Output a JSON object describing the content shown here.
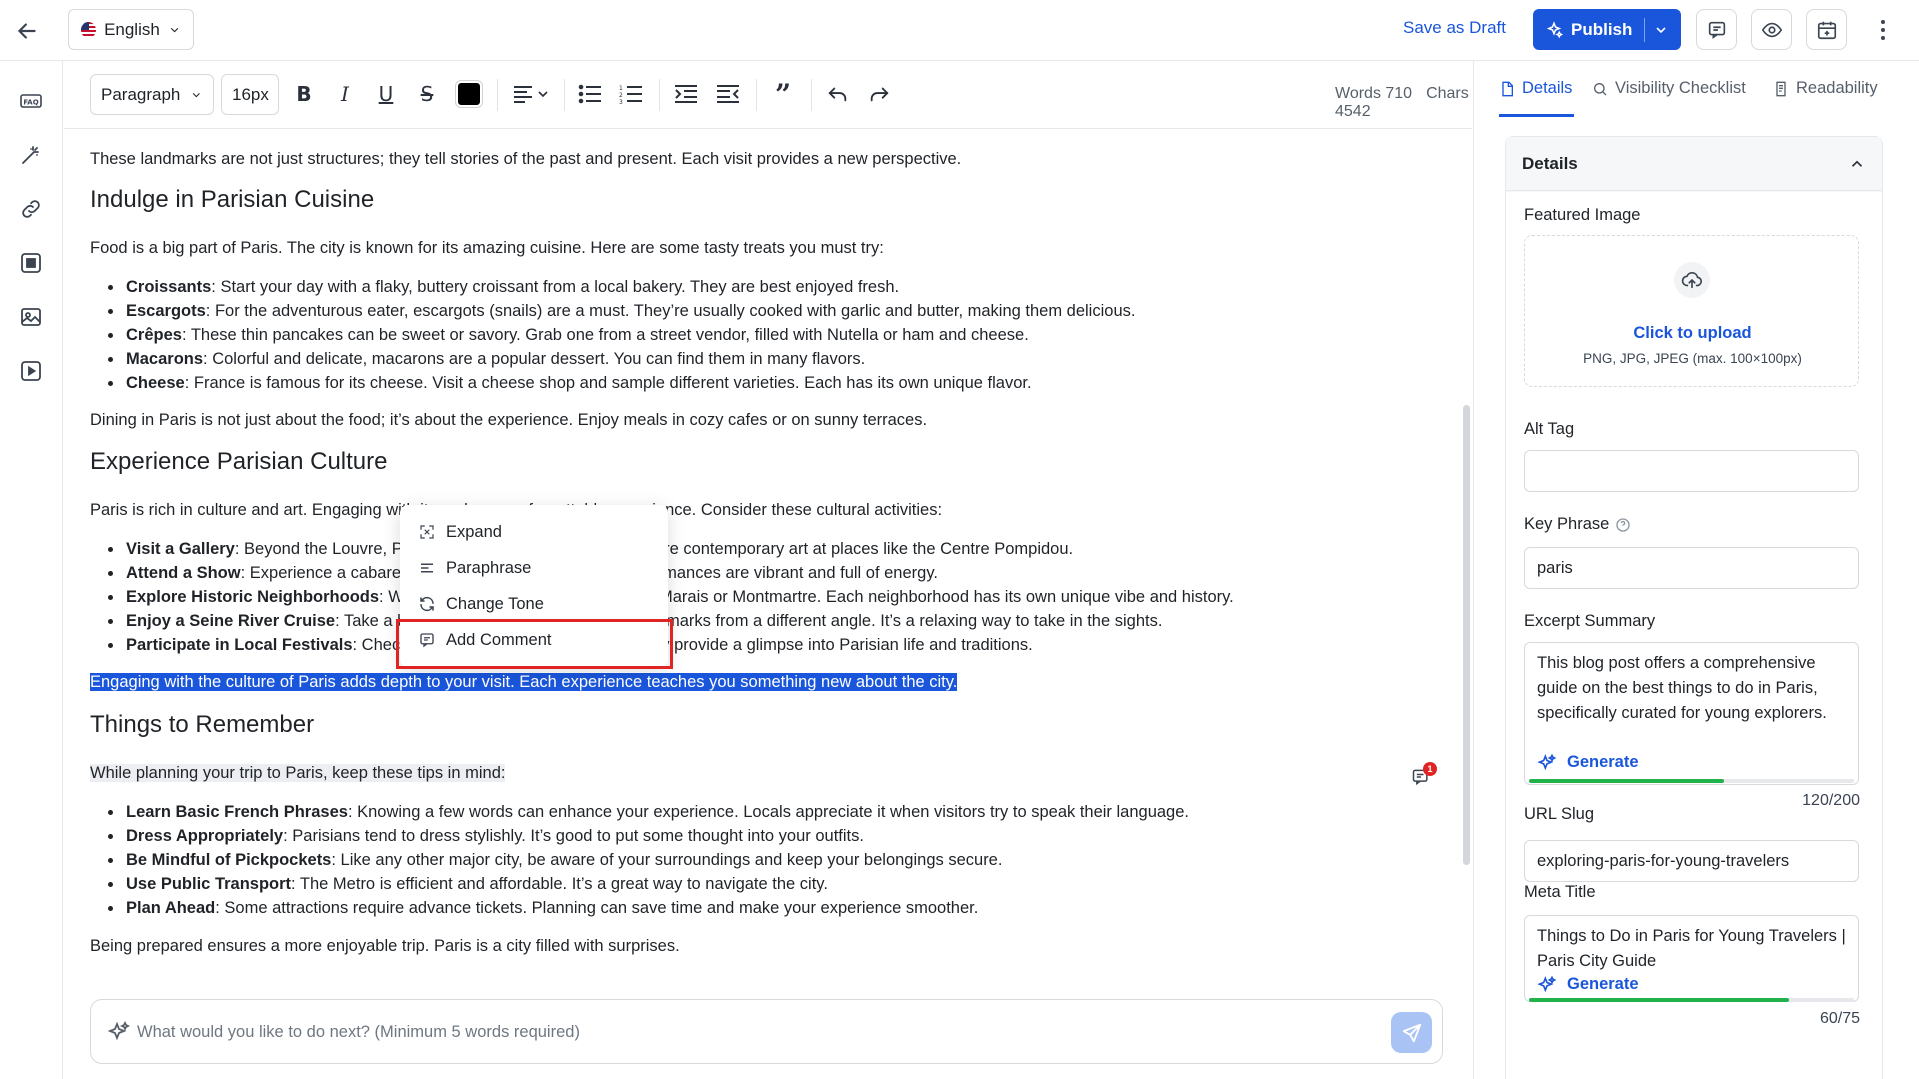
{
  "topbar": {
    "language": "English",
    "save_draft": "Save as Draft",
    "publish": "Publish",
    "icons": [
      "arrow-left-icon",
      "comment-icon",
      "eye-icon",
      "calendar-icon",
      "more-vertical-icon"
    ]
  },
  "rail": {
    "items": [
      "faq-icon",
      "magic-wand-icon",
      "link-icon",
      "stop-square-icon",
      "image-icon",
      "video-icon"
    ]
  },
  "toolbar": {
    "block_type": "Paragraph",
    "font_size": "16px",
    "text_color": "#000000",
    "words": "Words 710",
    "chars": "Chars 4542"
  },
  "doc": {
    "p1": "These landmarks are not just structures; they tell stories of the past and present. Each visit provides a new perspective.",
    "h_cuisine": "Indulge in Parisian Cuisine",
    "p_food": "Food is a big part of Paris. The city is known for its amazing cuisine. Here are some tasty treats you must try:",
    "food_items": [
      {
        "term": "Croissants",
        "text": ": Start your day with a flaky, buttery croissant from a local bakery. They are best enjoyed fresh."
      },
      {
        "term": "Escargots",
        "text": ": For the adventurous eater, escargots (snails) are a must. They’re usually cooked with garlic and butter, making them delicious."
      },
      {
        "term": "Crêpes",
        "text": ": These thin pancakes can be sweet or savory. Grab one from a street vendor, filled with Nutella or ham and cheese."
      },
      {
        "term": "Macarons",
        "text": ": Colorful and delicate, macarons are a popular dessert. You can find them in many flavors."
      },
      {
        "term": "Cheese",
        "text": ": France is famous for its cheese. Visit a cheese shop and sample different varieties. Each has its own unique flavor."
      }
    ],
    "p_dining": "Dining in Paris is not just about the food; it’s about the experience. Enjoy meals in cozy cafes or on sunny terraces.",
    "h_culture": "Experience Parisian Culture",
    "p_culture": "Paris is rich in culture and art. Engaging with it can be an unforgettable experience. Consider these cultural activities:",
    "culture_items": [
      {
        "term": "Visit a Gallery",
        "text": ": Beyond the Louvre, Paris has many galleries. Explore more contemporary art at places like the Centre Pompidou."
      },
      {
        "term": "Attend a Show",
        "text": ": Experience a cabaret or theater performance. The performances are vibrant and full of energy."
      },
      {
        "term": "Explore Historic Neighborhoods",
        "text": ": Walk through historic districts like Le Marais or Montmartre. Each neighborhood has its own unique vibe and history."
      },
      {
        "term": "Enjoy a Seine River Cruise",
        "text": ": Take a boat ride along the Seine to see landmarks from a different angle. It’s a relaxing way to take in the sights."
      },
      {
        "term": "Participate in Local Festivals",
        "text": ": Check out local festivals and events. They provide a glimpse into Parisian life and traditions."
      }
    ],
    "p_selected": "Engaging with the culture of Paris adds depth to your visit. Each experience teaches you something new about the city.",
    "h_remember": "Things to Remember",
    "p_tips": "While planning your trip to Paris, keep these tips in mind:",
    "tip_items": [
      {
        "term": "Learn Basic French Phrases",
        "text": ": Knowing a few words can enhance your experience. Locals appreciate it when visitors try to speak their language."
      },
      {
        "term": "Dress Appropriately",
        "text": ": Parisians tend to dress stylishly. It’s good to put some thought into your outfits."
      },
      {
        "term": "Be Mindful of Pickpockets",
        "text": ": Like any other major city, be aware of your surroundings and keep your belongings secure."
      },
      {
        "term": "Use Public Transport",
        "text": ": The Metro is efficient and affordable. It’s a great way to navigate the city."
      },
      {
        "term": "Plan Ahead",
        "text": ": Some attractions require advance tickets. Planning can save time and make your experience smoother."
      }
    ],
    "p_prepared": "Being prepared ensures a more enjoyable trip. Paris is a city filled with surprises.",
    "comment_count": "1"
  },
  "context_menu": {
    "items": [
      {
        "label": "Expand",
        "icon": "expand-icon"
      },
      {
        "label": "Paraphrase",
        "icon": "paraphrase-icon"
      },
      {
        "label": "Change Tone",
        "icon": "refresh-icon"
      },
      {
        "label": "Add Comment",
        "icon": "comment-icon"
      }
    ],
    "highlighted": "Add Comment"
  },
  "prompt": {
    "placeholder": "What would you like to do next? (Minimum 5 words required)"
  },
  "panel": {
    "tabs": [
      {
        "label": "Details",
        "active": true
      },
      {
        "label": "Visibility Checklist",
        "active": false
      },
      {
        "label": "Readability",
        "active": false
      }
    ],
    "section_title": "Details",
    "featured_image_label": "Featured Image",
    "upload_link": "Click to upload",
    "upload_hint": "PNG, JPG, JPEG (max. 100×100px)",
    "alt_tag_label": "Alt Tag",
    "alt_tag_value": "",
    "key_phrase_label": "Key Phrase",
    "key_phrase_value": "paris",
    "excerpt_label": "Excerpt Summary",
    "excerpt_value": "This blog post offers a comprehensive guide on the best things to do in Paris, specifically curated for young explorers.",
    "excerpt_generate": "Generate",
    "excerpt_count": "120/200",
    "excerpt_progress": 0.6,
    "slug_label": "URL Slug",
    "slug_value": "exploring-paris-for-young-travelers",
    "meta_title_label": "Meta Title",
    "meta_title_value": "Things to Do in Paris for Young Travelers | Paris City Guide",
    "meta_generate": "Generate",
    "meta_count": "60/75",
    "meta_progress": 0.8
  },
  "colors": {
    "primary": "#1a56db",
    "selection": "#1a56db",
    "highlight_box": "#e02424",
    "progress": "#22b24c"
  }
}
